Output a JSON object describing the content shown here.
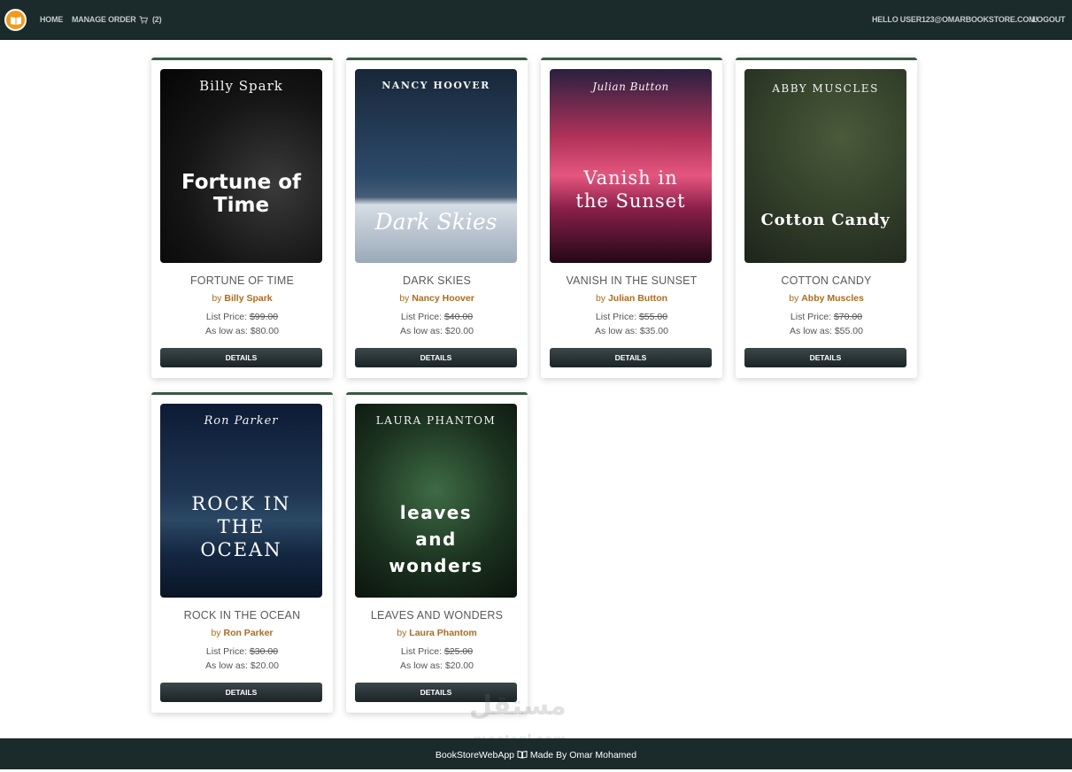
{
  "navbar": {
    "home": "HOME",
    "manage_order": "MANAGE ORDER",
    "cart_count": "(2)",
    "hello": "HELLO USER123@OMARBOOKSTORE.COM!",
    "logout": "LOGOUT"
  },
  "books": [
    {
      "cover_author": "Billy Spark",
      "cover_title": "Fortune of Time",
      "title": "FORTUNE OF TIME",
      "by": "by",
      "author": "Billy Spark",
      "list_label": "List Price:",
      "list_price": "$99.00",
      "low_label": "As low as:",
      "low_price": "$80.00",
      "button": "DETAILS"
    },
    {
      "cover_author": "NANCY HOOVER",
      "cover_title": "Dark Skies",
      "title": "DARK SKIES",
      "by": "by",
      "author": "Nancy Hoover",
      "list_label": "List Price:",
      "list_price": "$40.00",
      "low_label": "As low as:",
      "low_price": "$20.00",
      "button": "DETAILS"
    },
    {
      "cover_author": "Julian Button",
      "cover_title": "Vanish in the Sunset",
      "title": "VANISH IN THE SUNSET",
      "by": "by",
      "author": "Julian Button",
      "list_label": "List Price:",
      "list_price": "$55.00",
      "low_label": "As low as:",
      "low_price": "$35.00",
      "button": "DETAILS"
    },
    {
      "cover_author": "ABBY MUSCLES",
      "cover_title": "Cotton Candy",
      "title": "COTTON CANDY",
      "by": "by",
      "author": "Abby Muscles",
      "list_label": "List Price:",
      "list_price": "$70.00",
      "low_label": "As low as:",
      "low_price": "$55.00",
      "button": "DETAILS"
    },
    {
      "cover_author": "Ron Parker",
      "cover_title": "ROCK IN THE OCEAN",
      "title": "ROCK IN THE OCEAN",
      "by": "by",
      "author": "Ron Parker",
      "list_label": "List Price:",
      "list_price": "$30.00",
      "low_label": "As low as:",
      "low_price": "$20.00",
      "button": "DETAILS"
    },
    {
      "cover_author": "LAURA PHANTOM",
      "cover_title": "leaves and wonders",
      "title": "LEAVES AND WONDERS",
      "by": "by",
      "author": "Laura Phantom",
      "list_label": "List Price:",
      "list_price": "$25.00",
      "low_label": "As low as:",
      "low_price": "$20.00",
      "button": "DETAILS"
    }
  ],
  "footer": {
    "left": "BookStoreWebApp",
    "right": "Made By Omar Mohamed"
  },
  "watermark": {
    "arabic": "مستقل",
    "latin": "mostaql.com"
  },
  "colors": {
    "navbar": "#1b2a2b",
    "brand": "#f39a1c",
    "author_link": "#b46a1a",
    "card_top_border": "#3b5a42"
  },
  "icons": {
    "brand": "book-logo-icon",
    "cart": "cart-icon",
    "footer": "book-icon"
  }
}
